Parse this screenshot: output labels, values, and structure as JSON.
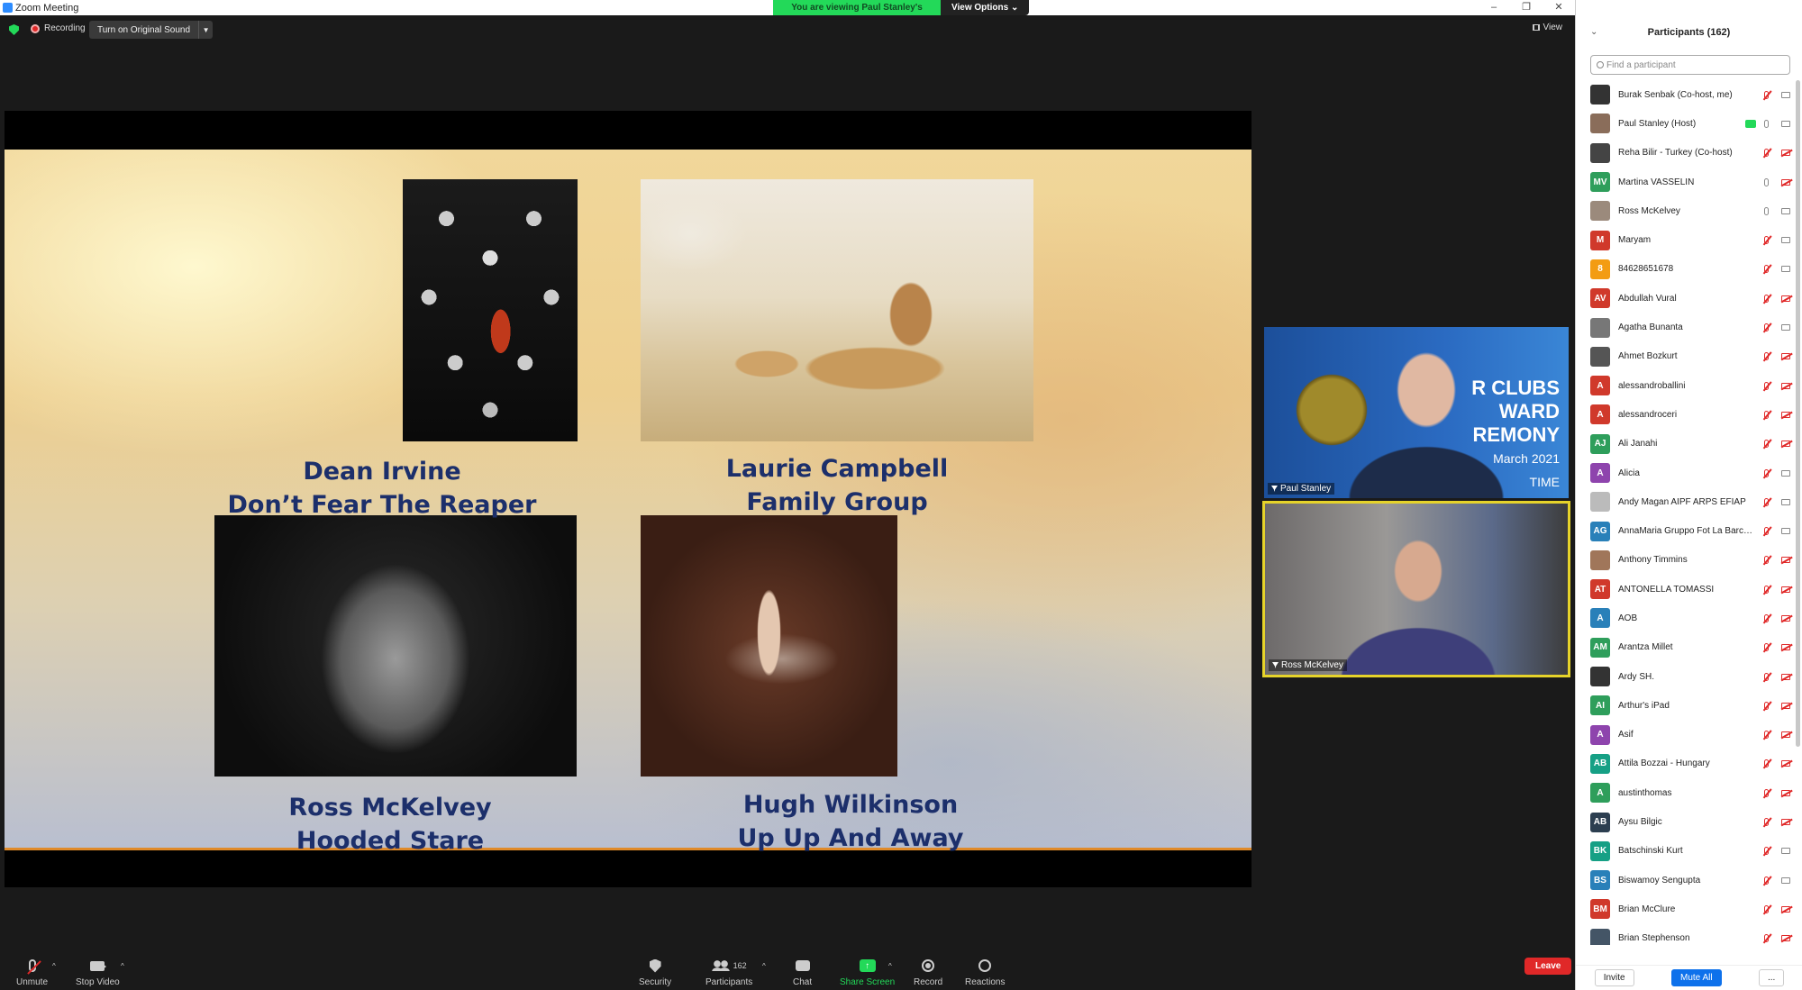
{
  "window": {
    "title": "Zoom Meeting",
    "controls": [
      "–",
      "❐",
      "✕"
    ]
  },
  "banner": {
    "viewing": "You are viewing Paul Stanley's screen",
    "view_options": "View Options ⌄"
  },
  "topbar": {
    "recording": "Recording",
    "original_sound": "Turn on Original Sound",
    "view": "View"
  },
  "slide": {
    "entries": [
      {
        "author": "Dean Irvine",
        "title": "Don’t Fear The Reaper"
      },
      {
        "author": "Laurie Campbell",
        "title": "Family Group"
      },
      {
        "author": "Ross McKelvey",
        "title": "Hooded Stare"
      },
      {
        "author": "Hugh Wilkinson",
        "title": "Up Up And Away"
      }
    ]
  },
  "videos": {
    "paul": {
      "name": "Paul Stanley",
      "banner_line1": "R CLUBS",
      "banner_line2": "WARD",
      "banner_line3": "REMONY",
      "banner_line4": "March 2021",
      "banner_line5": "TIME"
    },
    "ross": {
      "name": "Ross McKelvey"
    }
  },
  "toolbar": {
    "unmute": "Unmute",
    "stop_video": "Stop Video",
    "security": "Security",
    "participants": "Participants",
    "participants_count": "162",
    "chat": "Chat",
    "share_screen": "Share Screen",
    "record": "Record",
    "reactions": "Reactions",
    "leave": "Leave"
  },
  "panel": {
    "title": "Participants (162)",
    "search_placeholder": "Find a participant",
    "participants": [
      {
        "name": "Burak Senbak (Co-host, me)",
        "initials": "",
        "color": "#333333",
        "photo": true,
        "mic": "off",
        "cam": "on"
      },
      {
        "name": "Paul Stanley (Host)",
        "initials": "",
        "color": "#8a6d5a",
        "photo": true,
        "mic": "on",
        "cam": "on",
        "sharing": true
      },
      {
        "name": "Reha Bilir - Turkey (Co-host)",
        "initials": "",
        "color": "#444444",
        "photo": true,
        "mic": "off",
        "cam": "off"
      },
      {
        "name": "Martina VASSELIN",
        "initials": "MV",
        "color": "#2e9e5b",
        "mic": "on",
        "cam": "off"
      },
      {
        "name": "Ross McKelvey",
        "initials": "",
        "color": "#9b8a7c",
        "photo": true,
        "mic": "on",
        "cam": "on"
      },
      {
        "name": " Maryam",
        "initials": "M",
        "color": "#d0392b",
        "mic": "off",
        "cam": "on"
      },
      {
        "name": "84628651678",
        "initials": "8",
        "color": "#f39c12",
        "mic": "off",
        "cam": "on"
      },
      {
        "name": "Abdullah Vural",
        "initials": "AV",
        "color": "#d0392b",
        "mic": "off",
        "cam": "off"
      },
      {
        "name": "Agatha Bunanta",
        "initials": "",
        "color": "#777777",
        "photo": true,
        "mic": "off",
        "cam": "on"
      },
      {
        "name": "Ahmet Bozkurt",
        "initials": "",
        "color": "#555555",
        "photo": true,
        "mic": "off",
        "cam": "off"
      },
      {
        "name": "alessandroballini",
        "initials": "A",
        "color": "#d0392b",
        "mic": "off",
        "cam": "off"
      },
      {
        "name": "alessandroceri",
        "initials": "A",
        "color": "#d0392b",
        "mic": "off",
        "cam": "off"
      },
      {
        "name": "Ali Janahi",
        "initials": "AJ",
        "color": "#2e9e5b",
        "mic": "off",
        "cam": "off"
      },
      {
        "name": "Alicia",
        "initials": "A",
        "color": "#8e44ad",
        "mic": "off",
        "cam": "on"
      },
      {
        "name": "Andy Magan AIPF ARPS EFIAP",
        "initials": "",
        "color": "#bbbbbb",
        "photo": true,
        "mic": "off",
        "cam": "on"
      },
      {
        "name": "AnnaMaria Gruppo Fot La Barch...",
        "initials": "AG",
        "color": "#2980b9",
        "mic": "off",
        "cam": "on"
      },
      {
        "name": "Anthony Timmins",
        "initials": "",
        "color": "#a0765a",
        "photo": true,
        "mic": "off",
        "cam": "off"
      },
      {
        "name": "ANTONELLA TOMASSI",
        "initials": "AT",
        "color": "#d0392b",
        "mic": "off",
        "cam": "off"
      },
      {
        "name": "AOB",
        "initials": "A",
        "color": "#2980b9",
        "mic": "off",
        "cam": "off"
      },
      {
        "name": "Arantza Millet",
        "initials": "AM",
        "color": "#2e9e5b",
        "mic": "off",
        "cam": "off"
      },
      {
        "name": "Ardy SH.",
        "initials": "",
        "color": "#333333",
        "photo": true,
        "mic": "off",
        "cam": "off"
      },
      {
        "name": "Arthur's iPad",
        "initials": "AI",
        "color": "#2e9e5b",
        "mic": "off",
        "cam": "off"
      },
      {
        "name": "Asif",
        "initials": "A",
        "color": "#8e44ad",
        "mic": "off",
        "cam": "off"
      },
      {
        "name": "Attila Bozzai - Hungary",
        "initials": "AB",
        "color": "#16a085",
        "mic": "off",
        "cam": "off"
      },
      {
        "name": "austinthomas",
        "initials": "A",
        "color": "#2e9e5b",
        "mic": "off",
        "cam": "off"
      },
      {
        "name": "Aysu Bilgic",
        "initials": "AB",
        "color": "#2c3e50",
        "mic": "off",
        "cam": "off"
      },
      {
        "name": "Batschinski Kurt",
        "initials": "BK",
        "color": "#16a085",
        "mic": "off",
        "cam": "on"
      },
      {
        "name": "Biswamoy Sengupta",
        "initials": "BS",
        "color": "#2980b9",
        "mic": "off",
        "cam": "on"
      },
      {
        "name": "Brian McClure",
        "initials": "BM",
        "color": "#d0392b",
        "mic": "off",
        "cam": "off"
      },
      {
        "name": "Brian Stephenson",
        "initials": "",
        "color": "#445566",
        "photo": true,
        "mic": "off",
        "cam": "off"
      }
    ],
    "invite": "Invite",
    "mute_all": "Mute All",
    "more": "..."
  }
}
